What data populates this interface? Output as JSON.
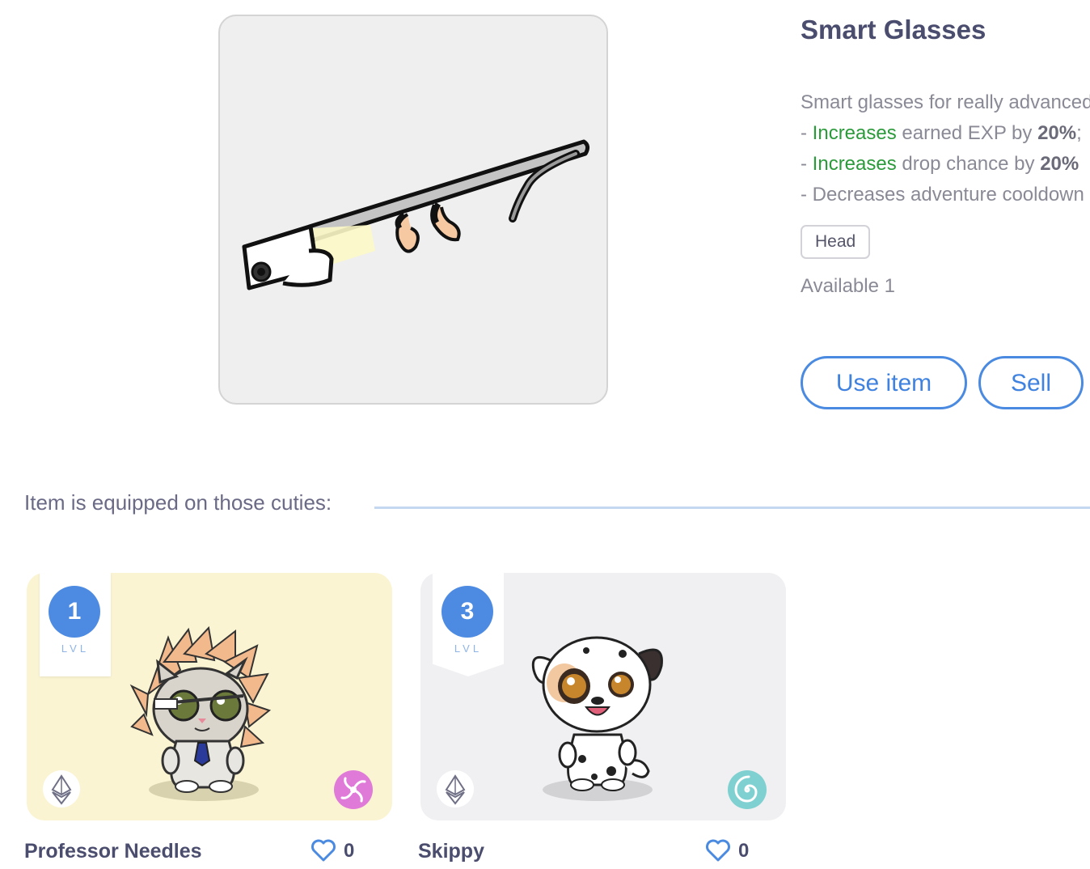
{
  "item": {
    "name": "Smart Glasses",
    "description": {
      "intro": "Smart glasses for really advanced",
      "line1_prefix": "- ",
      "line1_verb": "Increases",
      "line1_text": " earned EXP by ",
      "line1_value": "20%",
      "line1_suffix": ";",
      "line2_prefix": "- ",
      "line2_verb": "Increases",
      "line2_text": " drop chance by ",
      "line2_value": "20%",
      "line3": "- Decreases adventure cooldown"
    },
    "slot_tag": "Head",
    "available": "Available 1",
    "use_button": "Use item",
    "sell_button": "Sell",
    "image_icon": "smart-glasses-icon"
  },
  "equipped": {
    "label": "Item is equipped on those cuties:",
    "cuties": [
      {
        "name": "Professor Needles",
        "level": "1",
        "level_label": "LVL",
        "likes": "0",
        "chain_icon": "ethereum-icon",
        "element_icon": "air-element-icon",
        "element_color": "#e07ad8",
        "card_color": "#fbf4d2"
      },
      {
        "name": "Skippy",
        "level": "3",
        "level_label": "LVL",
        "likes": "0",
        "chain_icon": "ethereum-icon",
        "element_icon": "water-element-icon",
        "element_color": "#7fd0d0",
        "card_color": "#f0f0f2"
      }
    ]
  },
  "colors": {
    "accent": "#4a8ae0",
    "positive": "#2b9a3a",
    "title": "#4b4d6e",
    "divider": "#c5d8f2"
  }
}
